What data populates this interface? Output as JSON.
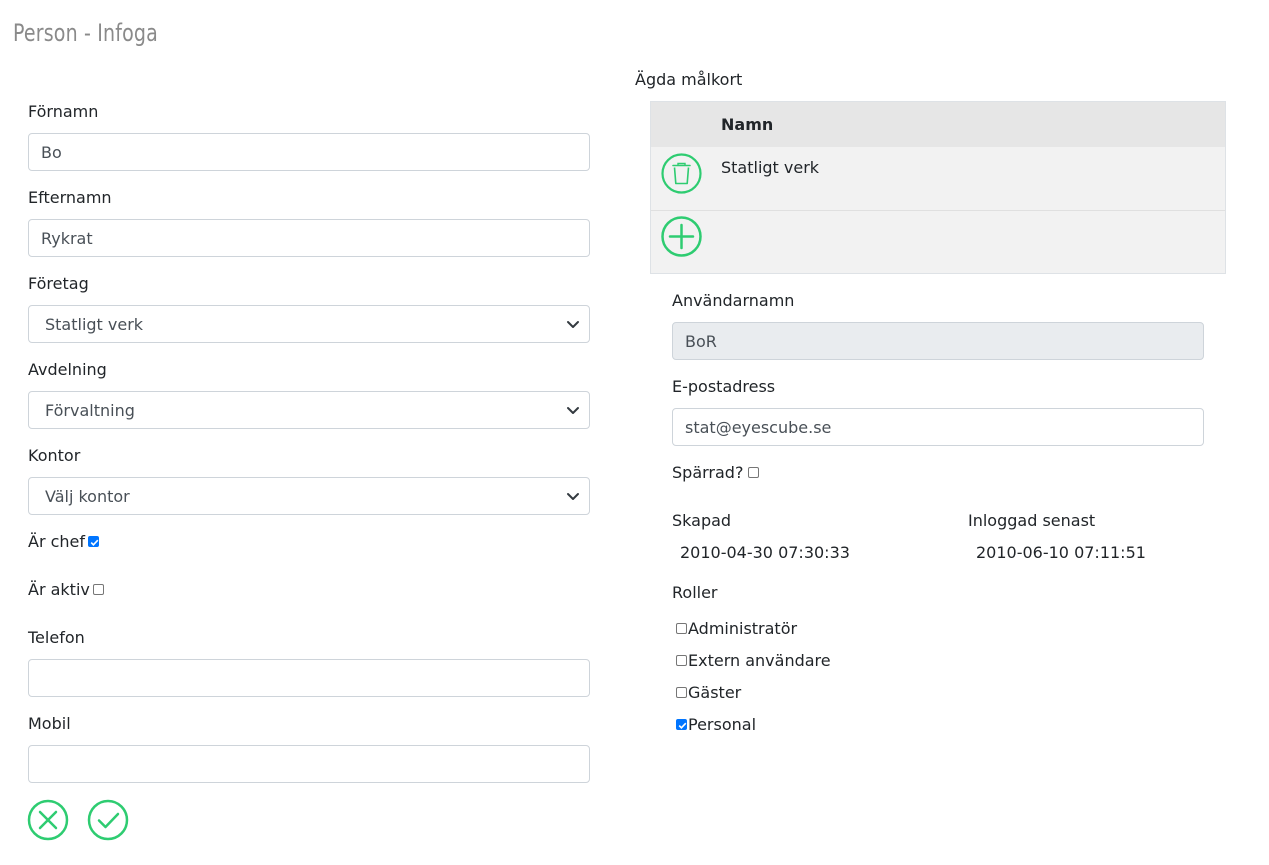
{
  "page": {
    "title": "Person - Infoga"
  },
  "form": {
    "first_name": {
      "label": "Förnamn",
      "value": "Bo"
    },
    "last_name": {
      "label": "Efternamn",
      "value": "Rykrat"
    },
    "company": {
      "label": "Företag",
      "value": "Statligt verk"
    },
    "department": {
      "label": "Avdelning",
      "value": "Förvaltning"
    },
    "office": {
      "label": "Kontor",
      "value": "Välj kontor"
    },
    "is_manager": {
      "label": "Är chef",
      "checked": true
    },
    "is_active": {
      "label": "Är aktiv",
      "checked": false
    },
    "phone": {
      "label": "Telefon",
      "value": ""
    },
    "mobile": {
      "label": "Mobil",
      "value": ""
    }
  },
  "target_cards": {
    "title": "Ägda målkort",
    "column_header": "Namn",
    "rows": [
      {
        "name": "Statligt verk"
      }
    ]
  },
  "account": {
    "username": {
      "label": "Användarnamn",
      "value": "BoR"
    },
    "email": {
      "label": "E-postadress",
      "value": "stat@eyescube.se"
    },
    "blocked": {
      "label": "Spärrad?",
      "checked": false
    },
    "created": {
      "label": "Skapad",
      "value": "2010-04-30 07:30:33"
    },
    "last_login": {
      "label": "Inloggad senast",
      "value": "2010-06-10 07:11:51"
    }
  },
  "roles": {
    "title": "Roller",
    "items": [
      {
        "label": "Administratör",
        "checked": false
      },
      {
        "label": "Extern användare",
        "checked": false
      },
      {
        "label": "Gäster",
        "checked": false
      },
      {
        "label": "Personal",
        "checked": true
      }
    ]
  },
  "colors": {
    "accent": "#2ecc71",
    "checkbox": "#0075ff",
    "muted_title": "#8a8a8a"
  },
  "icons": {
    "delete": "trash-icon",
    "add": "plus-circle-icon",
    "cancel": "x-circle-icon",
    "save": "check-circle-icon"
  }
}
